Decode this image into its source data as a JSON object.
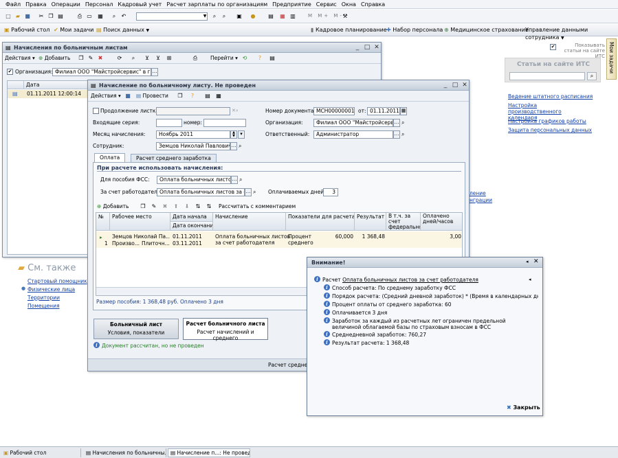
{
  "menu": [
    "Файл",
    "Правка",
    "Операции",
    "Персонал",
    "Кадровый учет",
    "Расчет зарплаты по организациям",
    "Предприятие",
    "Сервис",
    "Окна",
    "Справка"
  ],
  "panel": {
    "items": [
      "Рабочий стол",
      "Мои задачи",
      "Поиск данных"
    ],
    "right_items": [
      "Кадровое планирование",
      "Набор персонала",
      "Медицинское страхование",
      "Управление данными сотрудника"
    ]
  },
  "side_tab": "Мои задачи",
  "its": {
    "checkbox": "Показывать статьи на сайте ИТС",
    "title": "Статьи на сайте ИТС",
    "links": [
      "Ведение штатного расписания",
      "Настройка производственного календаря",
      "Настройка графиков работы",
      "Защита персональных данных"
    ],
    "partial_links": [
      "ление",
      "нграции"
    ]
  },
  "see_also": {
    "title": "См. также",
    "links": [
      "Стартовый помощник",
      "Физические лица",
      "Территории",
      "Помещения"
    ]
  },
  "list_window": {
    "title": "Начисления по больничным листам",
    "actions": "Действия",
    "add": "Добавить",
    "goto": "Перейти",
    "org_label": "Организация:",
    "org_value": "Филиал ООО \"Майстройсервис\" в г. Н",
    "col_date": "Дата",
    "row_date": "01.11.2011 12:00:14"
  },
  "doc": {
    "title": "Начисление по больничному листу. Не проведен",
    "actions": "Действия",
    "post": "Провести",
    "continuation_label": "Продолжение листка",
    "series_label": "Входящие серия:",
    "number_label": "номер:",
    "month_label": "Месяц начисления:",
    "month_value": "Ноябрь 2011",
    "employee_label": "Сотрудник:",
    "employee_value": "Земцов Николай Павлович",
    "docnum_label": "Номер документа:",
    "docnum_value": "МСН00000001",
    "from_label": "от:",
    "date_value": "01.11.2011",
    "org_label": "Организация:",
    "org_value": "Филиал ООО \"Майстройсервис",
    "resp_label": "Ответственный:",
    "resp_value": "Администратор",
    "tabs": [
      "Оплата",
      "Расчет среднего заработка"
    ],
    "section_title": "При расчете использовать начисления:",
    "fss_label": "Для пособия ФСС:",
    "fss_value": "Оплата больничных листов",
    "emp_cost_label": "За счет работодателя:",
    "emp_cost_value": "Оплата больничных листов за сче",
    "days_label": "Оплачиваемых дней:",
    "days_value": "3",
    "add_btn": "Добавить",
    "calc_btn": "Рассчитать с комментарием",
    "table": {
      "headers": [
        "№",
        "Рабочее место",
        "Дата начала",
        "Начисление",
        "Показатели для расчета",
        "Результат",
        "В т.ч. за счет федерального",
        "Оплачено дней/часов"
      ],
      "subheader": "Дата окончания",
      "row": {
        "num": "1",
        "place1": "Земцов Николай Па...",
        "place2": "Произво...",
        "place3": "Плиточн...",
        "start": "01.11.2011",
        "end": "03.11.2011",
        "accrual1": "Оплата больничных листов",
        "accrual2": "за счет работодателя",
        "indic1": "Процент",
        "indic2": "среднего",
        "indic_val": "60,000",
        "result": "1 368,48",
        "paid": "3,00"
      }
    },
    "summary": "Размер пособия: 1 368,48 руб. Оплачено 3 дня",
    "panel1_title": "Больничный лист",
    "panel1_sub": "Условия, показатели",
    "panel2_title": "Расчет больничного листа",
    "panel2_sub": "Расчет начислений и среднего",
    "status": "Документ рассчитан, но не проведен",
    "footer_partial": "Расчет среднего"
  },
  "popup": {
    "title": "Внимание!",
    "head_prefix": "Расчет",
    "head_link": "Оплата больничных листов за счет работодателя",
    "items": [
      "Способ расчета: По среднему заработку ФСС",
      "Порядок расчета: (Средний дневной заработок) * (Время в календарных днях)",
      "Процент оплаты от среднего заработка: 60",
      "Оплачивается 3 дня",
      "Заработок за каждый из расчетных лет ограничен предельной величиной облагаемой базы по страховым взносам в ФСС",
      "Среднедневной заработок: 760,27",
      "Результат расчета: 1 368,48"
    ],
    "close": "Закрыть"
  },
  "taskbar": [
    "Рабочий стол",
    "Начисления по больничны...",
    "Начисление п...: Не проведен"
  ]
}
